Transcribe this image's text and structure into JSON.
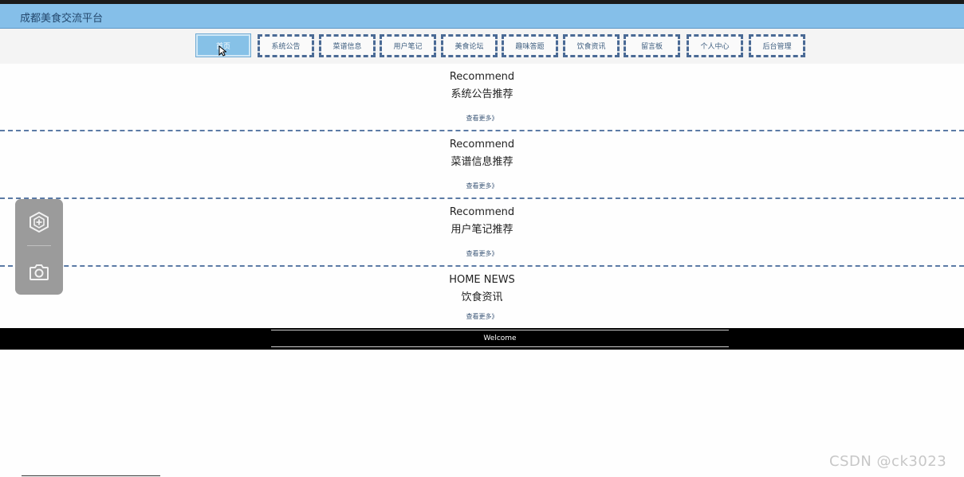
{
  "header": {
    "title": "成都美食交流平台"
  },
  "nav": {
    "items": [
      {
        "label": "首页"
      },
      {
        "label": "系统公告"
      },
      {
        "label": "菜谱信息"
      },
      {
        "label": "用户笔记"
      },
      {
        "label": "美食论坛"
      },
      {
        "label": "趣味答题"
      },
      {
        "label": "饮食资讯"
      },
      {
        "label": "留言板"
      },
      {
        "label": "个人中心"
      },
      {
        "label": "后台管理"
      }
    ]
  },
  "sections": [
    {
      "en": "Recommend",
      "cn": "系统公告推荐",
      "more": "查看更多》"
    },
    {
      "en": "Recommend",
      "cn": "菜谱信息推荐",
      "more": "查看更多》"
    },
    {
      "en": "Recommend",
      "cn": "用户笔记推荐",
      "more": "查看更多》"
    },
    {
      "en": "HOME NEWS",
      "cn": "饮食资讯",
      "more": "查看更多》"
    }
  ],
  "footer": {
    "text": "Welcome"
  },
  "float_panel": {
    "top_icon": "shield-plus-icon",
    "bottom_icon": "camera-icon"
  },
  "watermark": "CSDN @ck3023",
  "colors": {
    "header_bg": "#85bfe9",
    "nav_active": "#86c1e7",
    "nav_border": "#4a6a95",
    "footer_bg": "#000000"
  }
}
